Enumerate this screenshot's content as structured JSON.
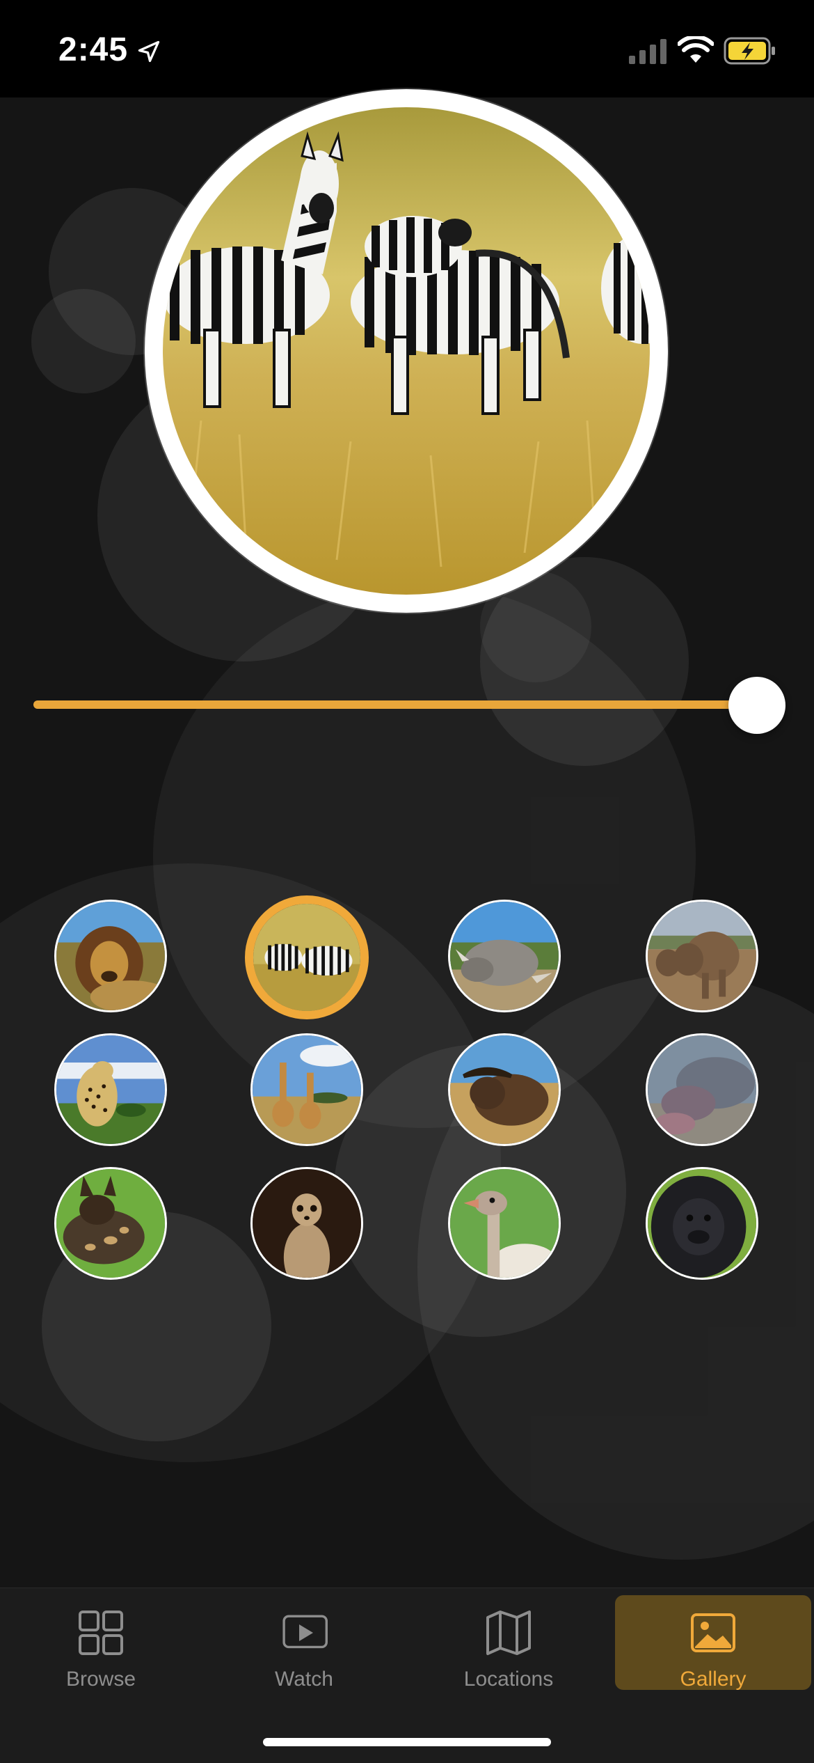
{
  "status_bar": {
    "time": "2:45",
    "icons": [
      "location-arrow-icon",
      "signal-icon",
      "wifi-icon",
      "battery-charging-icon"
    ]
  },
  "hero": {
    "subject": "zebras"
  },
  "slider": {
    "value": 1.0
  },
  "gallery": {
    "selected_index": 1,
    "thumbnails": [
      {
        "subject": "lion"
      },
      {
        "subject": "zebras"
      },
      {
        "subject": "rhinoceros"
      },
      {
        "subject": "elephants"
      },
      {
        "subject": "cheetah"
      },
      {
        "subject": "giraffes"
      },
      {
        "subject": "buffalo"
      },
      {
        "subject": "hippos"
      },
      {
        "subject": "wild-dog"
      },
      {
        "subject": "meerkat"
      },
      {
        "subject": "ostrich"
      },
      {
        "subject": "gorilla"
      }
    ]
  },
  "tab_bar": {
    "active": "gallery",
    "tabs": [
      {
        "id": "browse",
        "label": "Browse",
        "icon": "grid-icon"
      },
      {
        "id": "watch",
        "label": "Watch",
        "icon": "play-icon"
      },
      {
        "id": "locations",
        "label": "Locations",
        "icon": "map-icon"
      },
      {
        "id": "gallery",
        "label": "Gallery",
        "icon": "photo-icon"
      }
    ]
  },
  "colors": {
    "accent": "#f0a93a",
    "tab_active_bg": "#5e4a1c",
    "background": "#151515"
  }
}
